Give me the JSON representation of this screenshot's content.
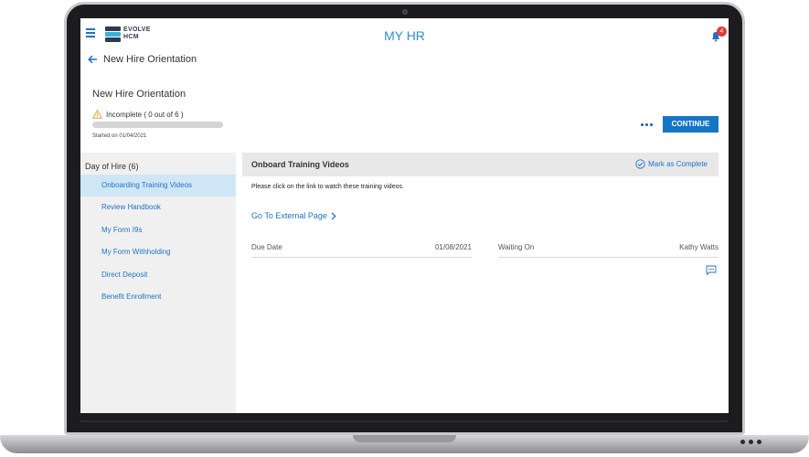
{
  "app": {
    "title": "MY HR",
    "logo_line1": "EVOLVE",
    "logo_line2": "HCM",
    "notification_count": "4"
  },
  "breadcrumb": {
    "label": "New Hire Orientation"
  },
  "task": {
    "title": "New Hire Orientation",
    "status": "Incomplete ( 0 out of 6 )",
    "progress_fraction": 0,
    "started": "Started on 01/04/2021",
    "continue_label": "CONTINUE"
  },
  "sidebar": {
    "group_label": "Day of Hire (6)",
    "items": [
      {
        "label": "Onboarding Training Videos",
        "active": true
      },
      {
        "label": "Review Handbook",
        "active": false
      },
      {
        "label": "My Form I9s",
        "active": false
      },
      {
        "label": "My Form Withholding",
        "active": false
      },
      {
        "label": "Direct Deposit",
        "active": false
      },
      {
        "label": "Benefit Enrollment",
        "active": false
      }
    ]
  },
  "panel": {
    "title": "Onboard Training Videos",
    "mark_complete_label": "Mark as Complete",
    "instructions": "Please click on the link to watch these training videos.",
    "link_label": "Go To External Page",
    "due_label": "Due Date",
    "due_value": "01/08/2021",
    "waiting_label": "Waiting On",
    "waiting_value": "Kathy Watts"
  },
  "colors": {
    "accent": "#1676c6",
    "title_blue": "#2d8fd5",
    "badge_red": "#e53935",
    "active_item_bg": "#cfe6f7"
  },
  "icons": [
    "hamburger-icon",
    "bell-icon",
    "back-arrow-icon",
    "warning-icon",
    "more-icon",
    "check-circle-icon",
    "chevron-right-icon",
    "chat-icon"
  ]
}
